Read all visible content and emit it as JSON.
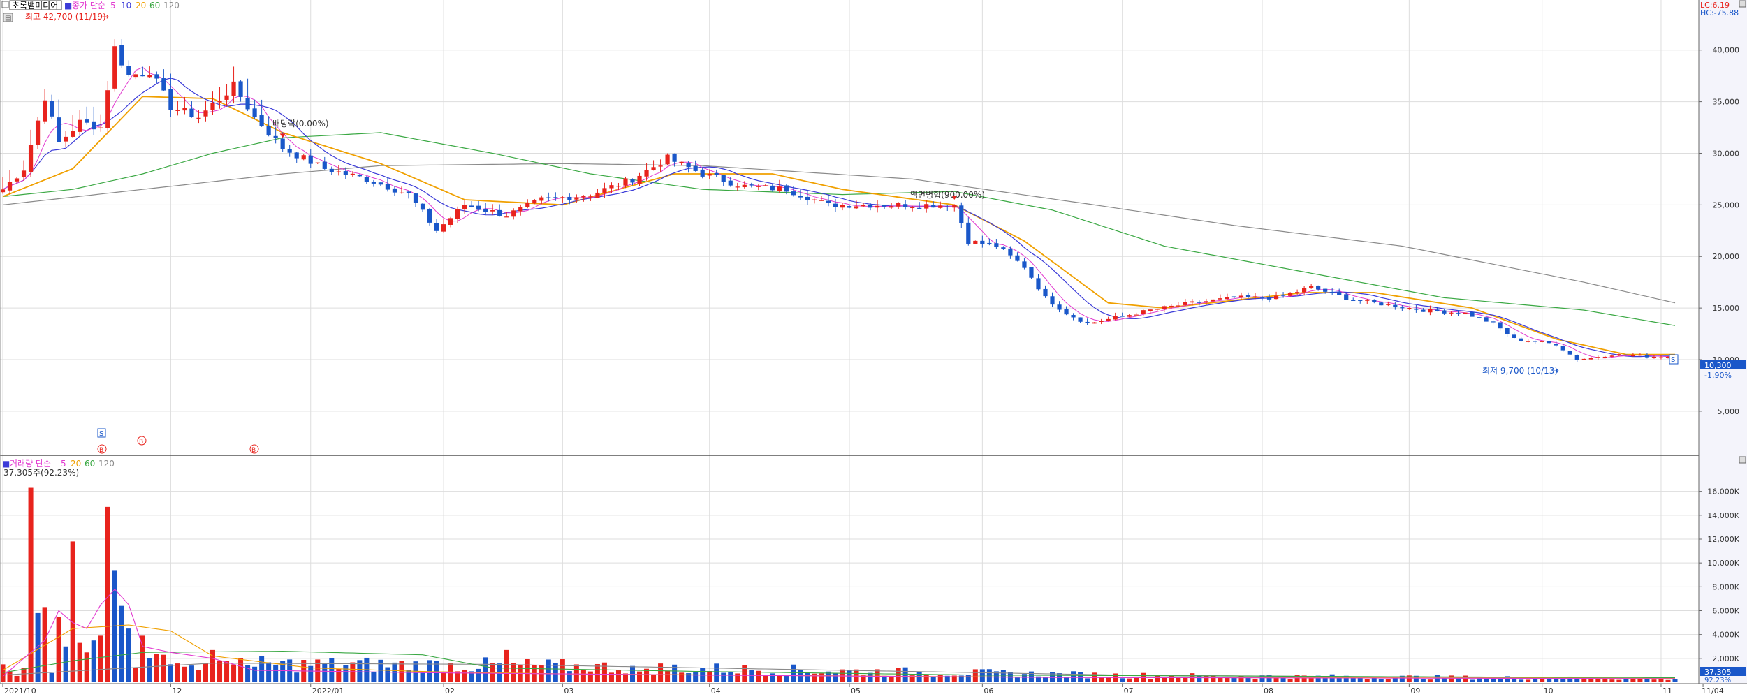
{
  "window": {
    "stock_name": "초록뱀미디어",
    "price_legend_label": "종가 단순",
    "volume_legend_label": "거래량 단순",
    "ma_periods": [
      "5",
      "10",
      "20",
      "60",
      "120"
    ],
    "lc_value": "LC:6.19",
    "hc_value": "HC:-75.88",
    "volume_readout": "37,305주(92.23%)"
  },
  "colors": {
    "up": "#e8231d",
    "down": "#1a57c9",
    "ma5": "#e23bd0",
    "ma10": "#3b3bd8",
    "ma20": "#f0a000",
    "ma60": "#3aa843",
    "ma120": "#8a8a8a",
    "axis_bg": "#f4f4fb",
    "grid": "#dddddd"
  },
  "annotations": {
    "high": "최고 42,700 (11/19)",
    "low": "최저 9,700 (10/13)",
    "dividend": "배당락(0.00%)",
    "split": "액면병합(900.00%)",
    "current_price": "10,300",
    "current_change": "-1.90%",
    "current_volume": "37,305",
    "current_volume_change": "92.23%",
    "signal_s": "S",
    "signal_b": "B"
  },
  "chart_data": [
    {
      "type": "candlestick",
      "title": "",
      "series_names": [
        "5",
        "10",
        "20",
        "60",
        "120"
      ],
      "y_ticks": [
        "40,000",
        "35,000",
        "30,000",
        "25,000",
        "20,000",
        "15,000",
        "10,000",
        "5,000"
      ],
      "y_tick_values": [
        40000,
        35000,
        30000,
        25000,
        20000,
        15000,
        10000,
        5000
      ],
      "ylim": [
        1000,
        43500
      ],
      "x_ticks": [
        "2021/10",
        "12",
        "2022/01",
        "02",
        "03",
        "04",
        "05",
        "06",
        "07",
        "08",
        "09",
        "10",
        "11",
        "11/04"
      ],
      "x_tick_index": [
        0,
        24,
        44,
        63,
        80,
        101,
        121,
        140,
        160,
        180,
        201,
        220,
        237,
        243
      ],
      "n_bars": 240,
      "anchors": [
        [
          0,
          26500
        ],
        [
          3,
          28500
        ],
        [
          6,
          35500
        ],
        [
          8,
          31000
        ],
        [
          11,
          33000
        ],
        [
          14,
          32500
        ],
        [
          16,
          40200
        ],
        [
          18,
          37500
        ],
        [
          21,
          38000
        ],
        [
          24,
          34500
        ],
        [
          28,
          33500
        ],
        [
          33,
          36500
        ],
        [
          36,
          33500
        ],
        [
          40,
          30500
        ],
        [
          46,
          28500
        ],
        [
          52,
          27500
        ],
        [
          58,
          26000
        ],
        [
          62,
          22500
        ],
        [
          66,
          25000
        ],
        [
          72,
          24000
        ],
        [
          77,
          25500
        ],
        [
          84,
          26000
        ],
        [
          90,
          27500
        ],
        [
          95,
          29500
        ],
        [
          100,
          28000
        ],
        [
          106,
          26800
        ],
        [
          112,
          26500
        ],
        [
          118,
          25000
        ],
        [
          122,
          25000
        ],
        [
          132,
          25000
        ],
        [
          136,
          25000
        ],
        [
          138,
          21500
        ],
        [
          142,
          21000
        ],
        [
          146,
          19000
        ],
        [
          149,
          16000
        ],
        [
          152,
          14500
        ],
        [
          155,
          13500
        ],
        [
          160,
          14200
        ],
        [
          164,
          14800
        ],
        [
          170,
          15500
        ],
        [
          176,
          16000
        ],
        [
          182,
          16000
        ],
        [
          187,
          17000
        ],
        [
          193,
          15800
        ],
        [
          198,
          15300
        ],
        [
          203,
          14800
        ],
        [
          209,
          14500
        ],
        [
          213,
          13500
        ],
        [
          216,
          12000
        ],
        [
          222,
          11500
        ],
        [
          225,
          10000
        ],
        [
          230,
          10500
        ],
        [
          236,
          10300
        ],
        [
          239,
          10300
        ]
      ],
      "ma_anchors": {
        "ma20": [
          [
            0,
            25800
          ],
          [
            10,
            28500
          ],
          [
            20,
            35500
          ],
          [
            30,
            35300
          ],
          [
            40,
            32000
          ],
          [
            54,
            29000
          ],
          [
            66,
            25500
          ],
          [
            80,
            25000
          ],
          [
            96,
            28000
          ],
          [
            110,
            28000
          ],
          [
            120,
            26500
          ],
          [
            136,
            25000
          ],
          [
            146,
            21500
          ],
          [
            158,
            15500
          ],
          [
            166,
            15000
          ],
          [
            186,
            16500
          ],
          [
            196,
            16500
          ],
          [
            210,
            15000
          ],
          [
            222,
            12000
          ],
          [
            232,
            10500
          ],
          [
            239,
            10500
          ]
        ],
        "ma60": [
          [
            0,
            25800
          ],
          [
            10,
            26500
          ],
          [
            20,
            28000
          ],
          [
            30,
            30000
          ],
          [
            40,
            31500
          ],
          [
            54,
            32000
          ],
          [
            70,
            30000
          ],
          [
            84,
            28000
          ],
          [
            100,
            26500
          ],
          [
            120,
            26000
          ],
          [
            136,
            26300
          ],
          [
            150,
            24500
          ],
          [
            166,
            21000
          ],
          [
            186,
            18500
          ],
          [
            206,
            16000
          ],
          [
            226,
            14800
          ],
          [
            239,
            13300
          ]
        ],
        "ma120": [
          [
            0,
            25000
          ],
          [
            20,
            26500
          ],
          [
            40,
            28000
          ],
          [
            54,
            28800
          ],
          [
            80,
            29000
          ],
          [
            100,
            28800
          ],
          [
            130,
            27500
          ],
          [
            156,
            25000
          ],
          [
            176,
            23000
          ],
          [
            200,
            21000
          ],
          [
            226,
            17500
          ],
          [
            239,
            15500
          ]
        ]
      }
    },
    {
      "type": "bar",
      "title": "",
      "y_ticks": [
        "16,000K",
        "14,000K",
        "12,000K",
        "10,000K",
        "8,000K",
        "6,000K",
        "4,000K",
        "2,000K"
      ],
      "y_tick_values": [
        16000,
        14000,
        12000,
        10000,
        8000,
        6000,
        4000,
        2000
      ],
      "ylim": [
        0,
        16800
      ],
      "unit": "K",
      "spikes": [
        [
          0,
          1500,
          "up"
        ],
        [
          1,
          900,
          "up"
        ],
        [
          3,
          1200,
          "up"
        ],
        [
          4,
          16300,
          "up"
        ],
        [
          5,
          5800,
          "down"
        ],
        [
          6,
          6300,
          "up"
        ],
        [
          8,
          5500,
          "up"
        ],
        [
          9,
          3000,
          "down"
        ],
        [
          10,
          11800,
          "up"
        ],
        [
          11,
          3300,
          "up"
        ],
        [
          12,
          2500,
          "up"
        ],
        [
          13,
          3500,
          "down"
        ],
        [
          14,
          3900,
          "up"
        ],
        [
          15,
          14700,
          "up"
        ],
        [
          16,
          9400,
          "down"
        ],
        [
          17,
          6400,
          "down"
        ],
        [
          18,
          4500,
          "down"
        ],
        [
          20,
          3900,
          "up"
        ],
        [
          21,
          2000,
          "down"
        ],
        [
          22,
          2400,
          "up"
        ],
        [
          23,
          2300,
          "up"
        ],
        [
          24,
          1500,
          "down"
        ],
        [
          26,
          1300,
          "up"
        ],
        [
          28,
          1000,
          "up"
        ],
        [
          30,
          2700,
          "up"
        ],
        [
          32,
          1800,
          "up"
        ],
        [
          34,
          2000,
          "up"
        ],
        [
          36,
          1300,
          "down"
        ],
        [
          72,
          2700,
          "up"
        ],
        [
          84,
          900,
          "up"
        ],
        [
          91,
          900,
          "up"
        ],
        [
          97,
          800,
          "up"
        ],
        [
          168,
          450,
          "up"
        ]
      ],
      "vma5_anchors": [
        [
          0,
          500
        ],
        [
          6,
          3500
        ],
        [
          8,
          6000
        ],
        [
          10,
          5000
        ],
        [
          12,
          4500
        ],
        [
          14,
          6500
        ],
        [
          16,
          7800
        ],
        [
          18,
          6500
        ],
        [
          20,
          3000
        ],
        [
          24,
          2500
        ],
        [
          30,
          2000
        ],
        [
          36,
          1000
        ],
        [
          60,
          800
        ],
        [
          100,
          600
        ],
        [
          150,
          400
        ],
        [
          239,
          300
        ]
      ],
      "vma20_anchors": [
        [
          0,
          1000
        ],
        [
          10,
          4500
        ],
        [
          18,
          4800
        ],
        [
          24,
          4300
        ],
        [
          30,
          2200
        ],
        [
          44,
          1200
        ],
        [
          60,
          900
        ],
        [
          80,
          700
        ],
        [
          140,
          450
        ],
        [
          239,
          320
        ]
      ],
      "vma60_anchors": [
        [
          0,
          800
        ],
        [
          10,
          1800
        ],
        [
          20,
          2500
        ],
        [
          40,
          2600
        ],
        [
          60,
          2300
        ],
        [
          70,
          1200
        ],
        [
          100,
          900
        ],
        [
          140,
          600
        ],
        [
          239,
          380
        ]
      ],
      "vma120_anchors": [
        [
          0,
          600
        ],
        [
          30,
          1600
        ],
        [
          70,
          1500
        ],
        [
          100,
          1200
        ],
        [
          130,
          900
        ],
        [
          160,
          600
        ],
        [
          239,
          300
        ]
      ]
    }
  ]
}
